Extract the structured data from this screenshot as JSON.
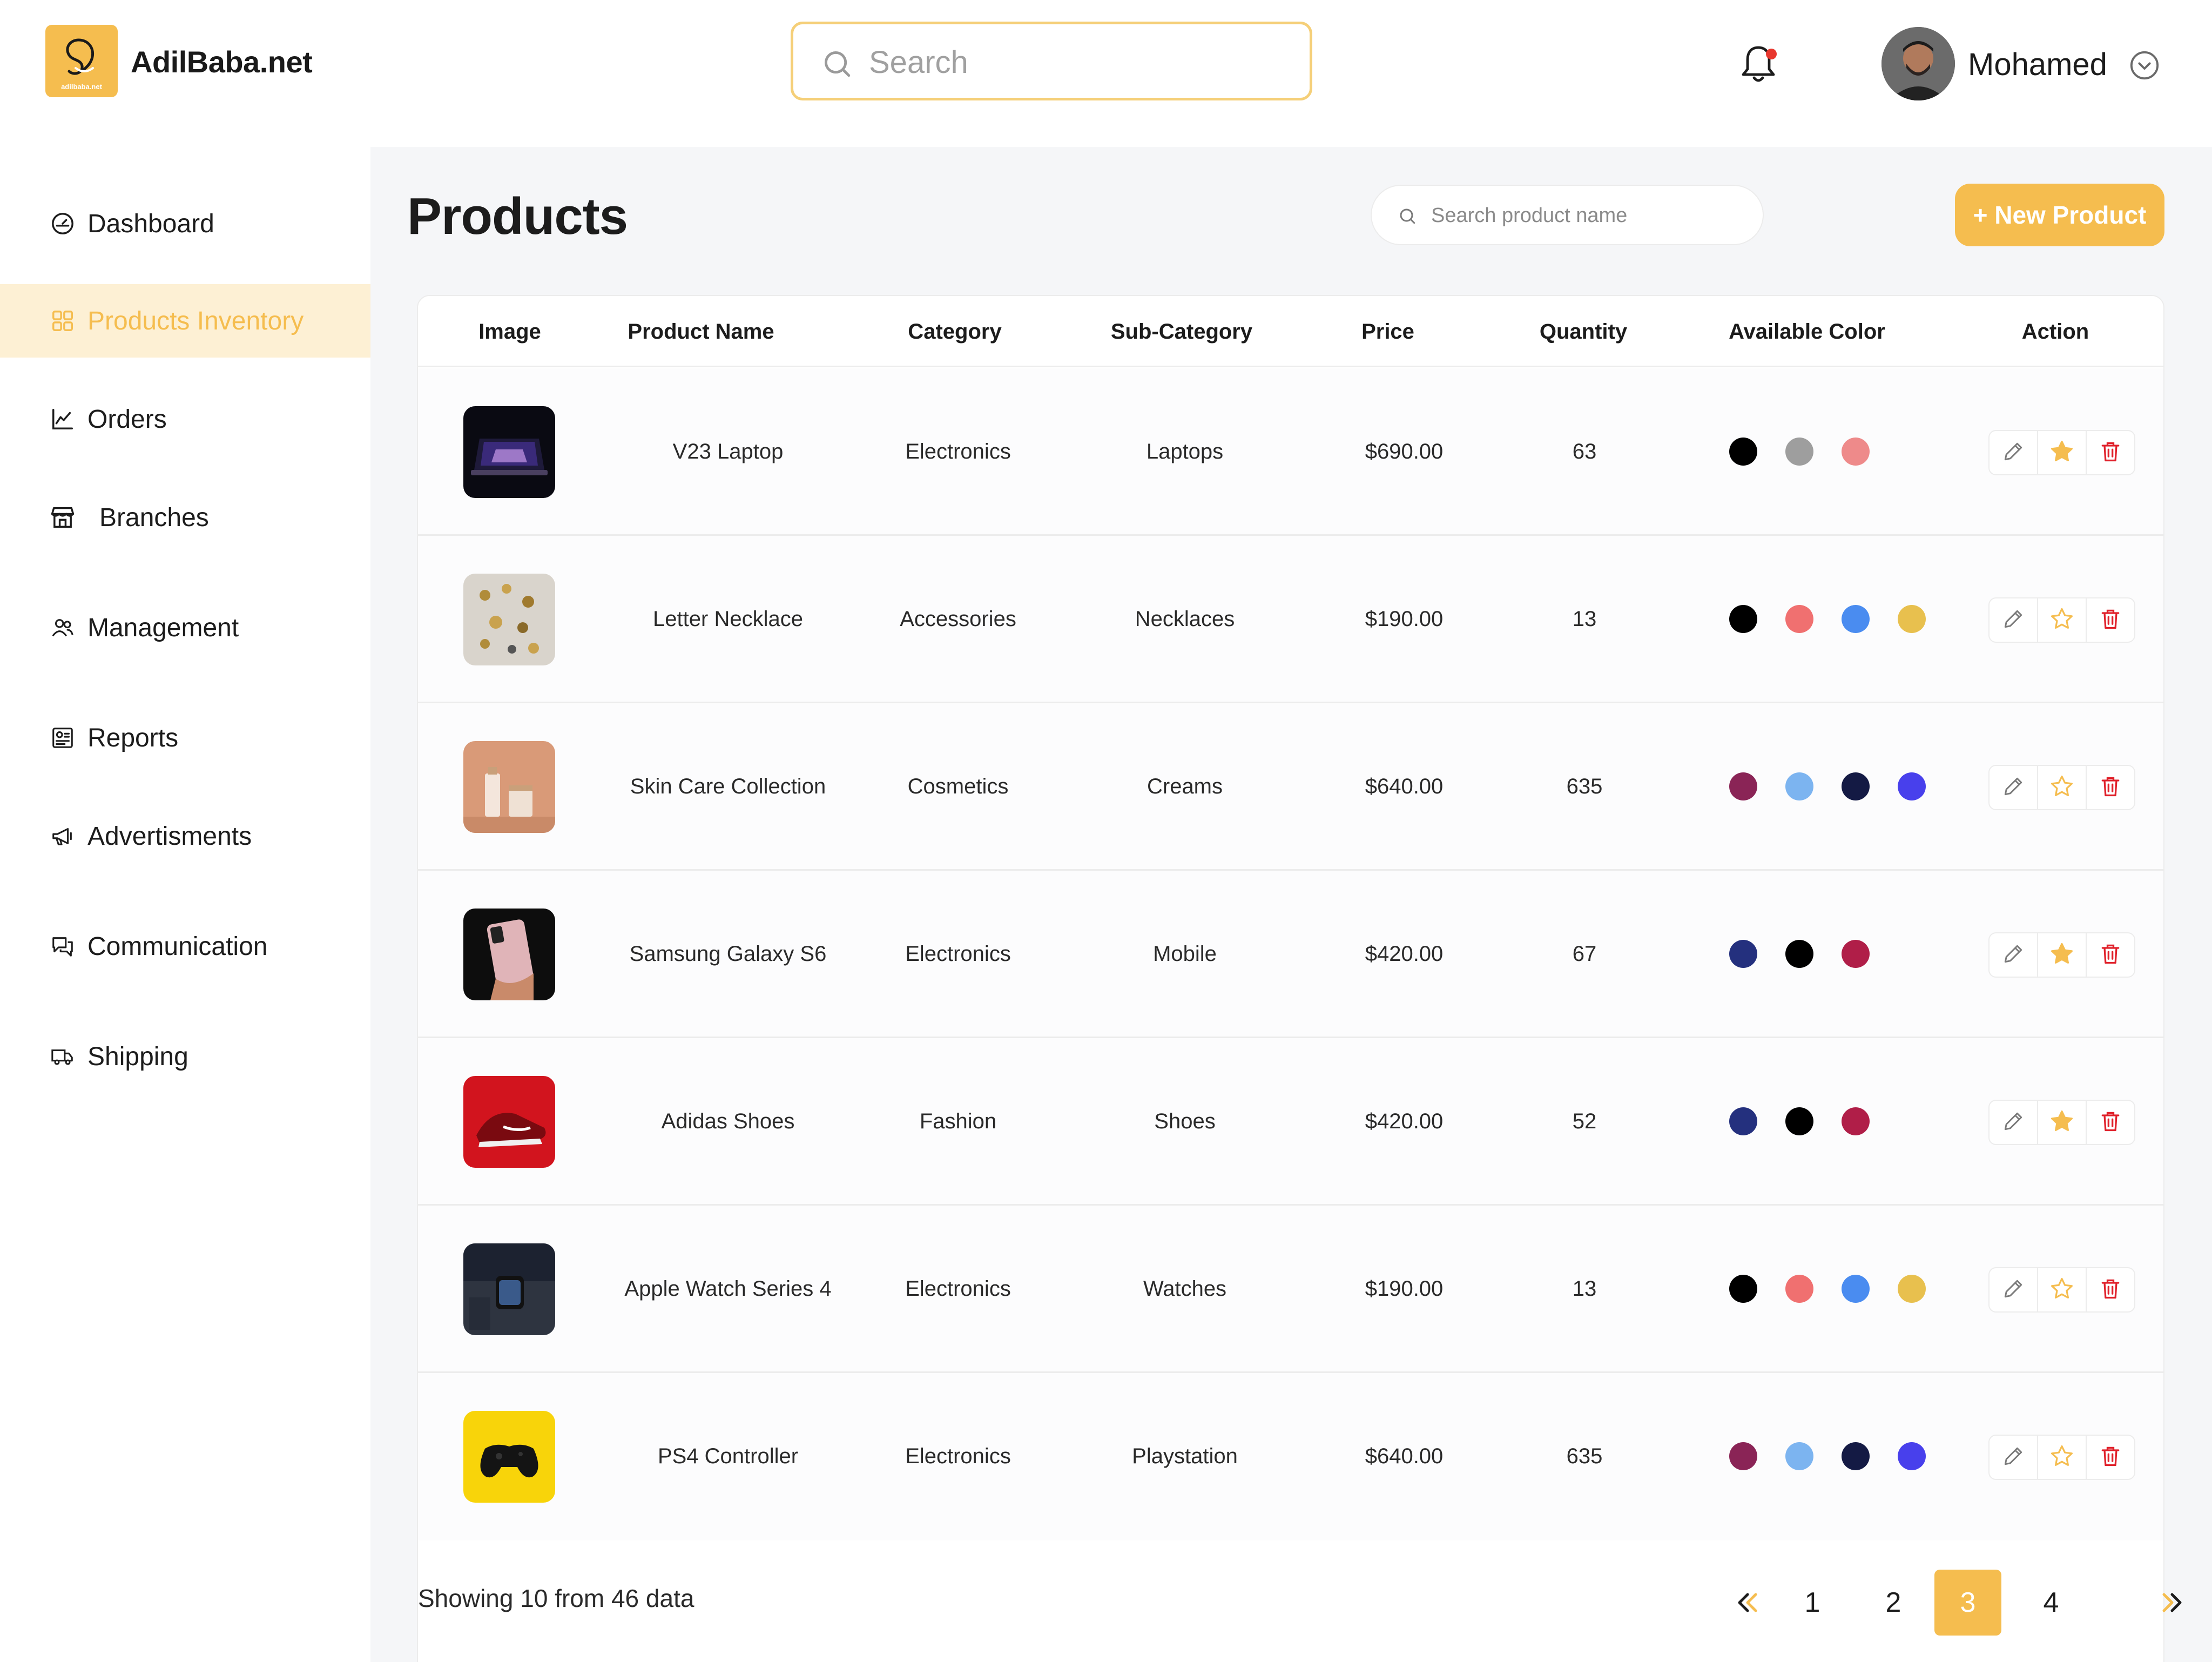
{
  "header": {
    "logo_small": "adilbaba.net",
    "brand": "AdilBaba.net",
    "search_placeholder": "Search",
    "user_name": "Mohamed"
  },
  "sidebar": {
    "items": [
      {
        "label": "Dashboard",
        "icon": "dashboard-gauge-icon",
        "active": false
      },
      {
        "label": "Products Inventory",
        "icon": "grid-icon",
        "active": true
      },
      {
        "label": "Orders",
        "icon": "line-chart-icon",
        "active": false
      },
      {
        "label": "Branches",
        "icon": "store-icon",
        "active": false
      },
      {
        "label": "Management",
        "icon": "users-icon",
        "active": false
      },
      {
        "label": "Reports",
        "icon": "report-icon",
        "active": false
      },
      {
        "label": "Advertisments",
        "icon": "megaphone-icon",
        "active": false
      },
      {
        "label": "Communication",
        "icon": "chat-icon",
        "active": false
      },
      {
        "label": "Shipping",
        "icon": "truck-icon",
        "active": false
      }
    ]
  },
  "main": {
    "title": "Products",
    "search_placeholder": "Search product name",
    "new_button": "+ New Product"
  },
  "table": {
    "columns": [
      "Image",
      "Product Name",
      "Category",
      "Sub-Category",
      "Price",
      "Quantity",
      "Available Color",
      "Action"
    ],
    "rows": [
      {
        "name": "V23 Laptop",
        "category": "Electronics",
        "subcategory": "Laptops",
        "price": "$690.00",
        "quantity": "63",
        "colors": [
          "#000000",
          "#9e9e9e",
          "#ee8a8a"
        ],
        "starred": true,
        "image_icon": "laptop-image"
      },
      {
        "name": "Letter Necklace",
        "category": "Accessories",
        "subcategory": "Necklaces",
        "price": "$190.00",
        "quantity": "13",
        "colors": [
          "#000000",
          "#f07070",
          "#4a8cf0",
          "#e8c04e"
        ],
        "starred": false,
        "image_icon": "necklace-image"
      },
      {
        "name": "Skin Care Collection",
        "category": "Cosmetics",
        "subcategory": "Creams",
        "price": "$640.00",
        "quantity": "635",
        "colors": [
          "#8a2456",
          "#7cb4f0",
          "#141a44",
          "#4840ec"
        ],
        "starred": false,
        "image_icon": "skincare-image"
      },
      {
        "name": "Samsung Galaxy S6",
        "category": "Electronics",
        "subcategory": "Mobile",
        "price": "$420.00",
        "quantity": "67",
        "colors": [
          "#24307e",
          "#000000",
          "#b01e48"
        ],
        "starred": true,
        "image_icon": "phone-image"
      },
      {
        "name": "Adidas Shoes",
        "category": "Fashion",
        "subcategory": "Shoes",
        "price": "$420.00",
        "quantity": "52",
        "colors": [
          "#24307e",
          "#000000",
          "#b01e48"
        ],
        "starred": true,
        "image_icon": "shoe-image"
      },
      {
        "name": "Apple Watch Series 4",
        "category": "Electronics",
        "subcategory": "Watches",
        "price": "$190.00",
        "quantity": "13",
        "colors": [
          "#000000",
          "#f07070",
          "#4a8cf0",
          "#e8c04e"
        ],
        "starred": false,
        "image_icon": "watch-image"
      },
      {
        "name": "PS4 Controller",
        "category": "Electronics",
        "subcategory": "Playstation",
        "price": "$640.00",
        "quantity": "635",
        "colors": [
          "#8a2456",
          "#7cb4f0",
          "#141a44",
          "#4840ec"
        ],
        "starred": false,
        "image_icon": "controller-image"
      }
    ]
  },
  "footer": {
    "showing": "Showing 10 from 46 data",
    "pages": [
      "1",
      "2",
      "3",
      "4"
    ],
    "active_page": "3"
  },
  "colors": {
    "accent": "#f5bd4f",
    "delete": "#e0202a"
  }
}
